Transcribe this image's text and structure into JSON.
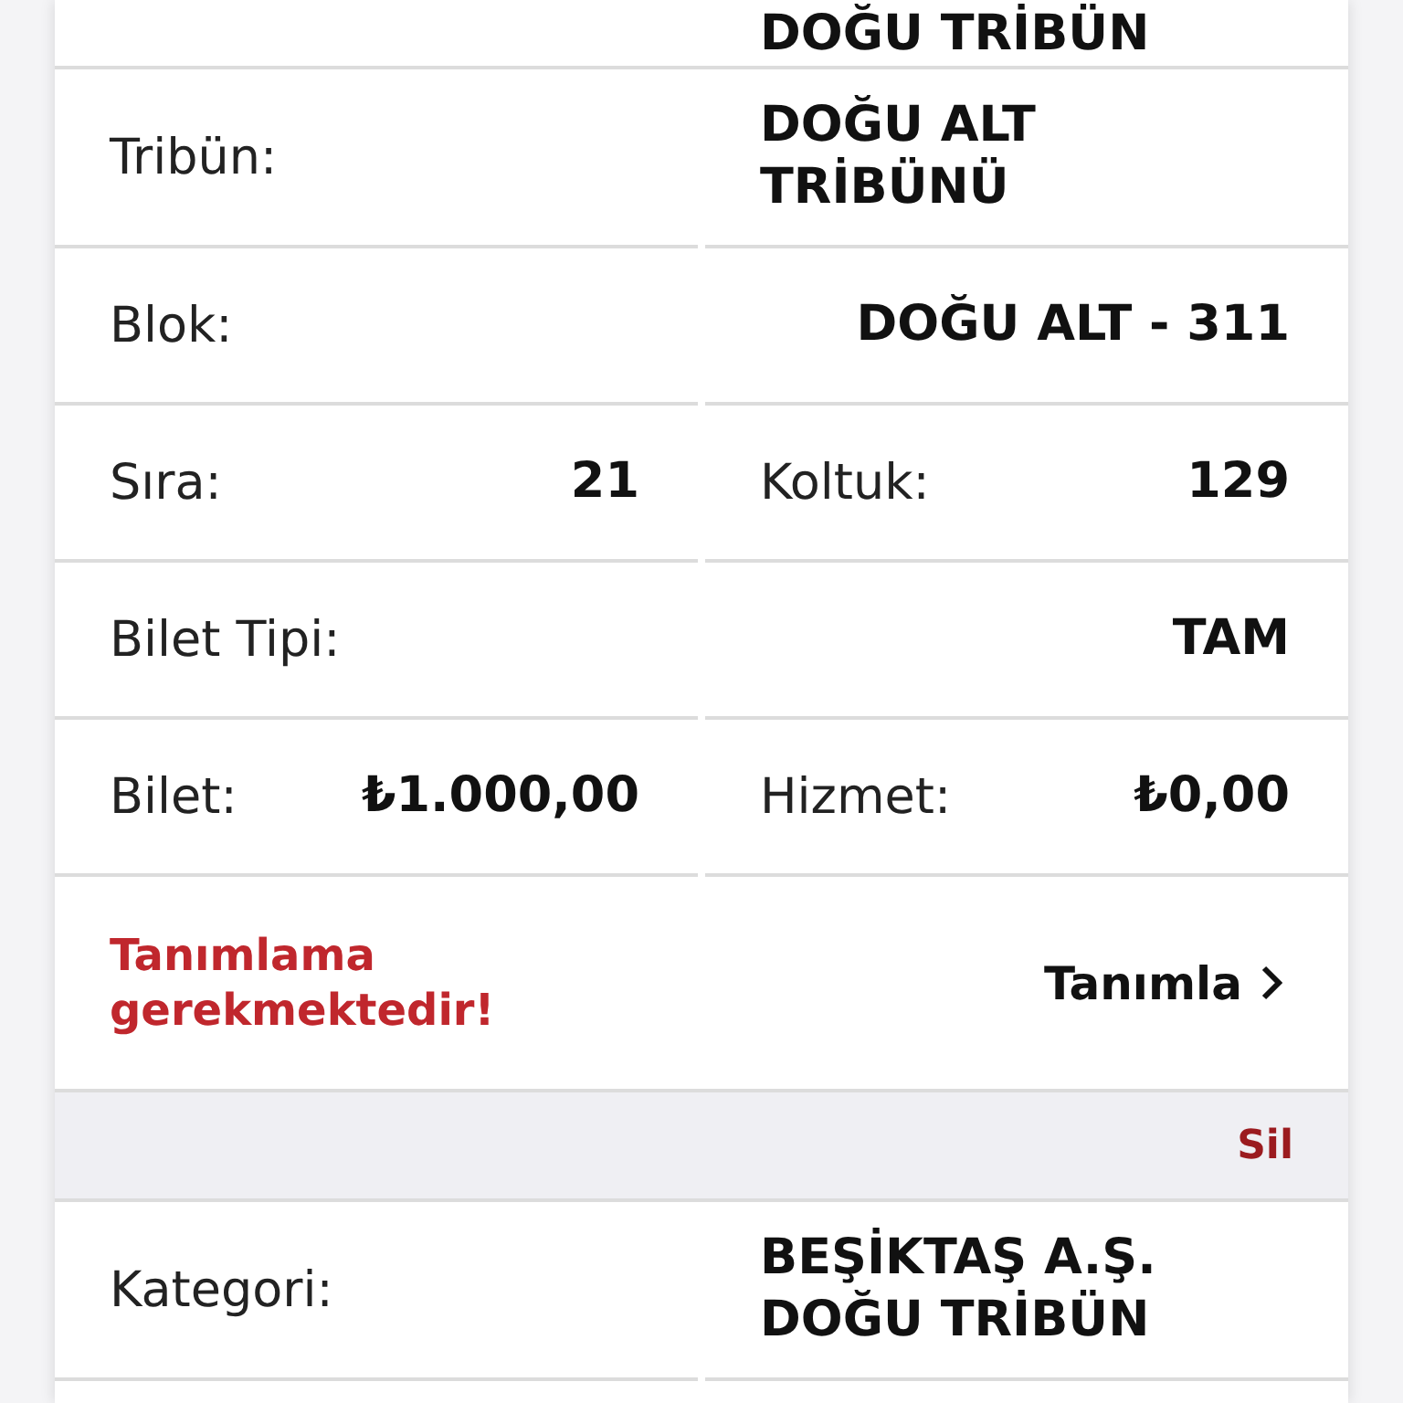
{
  "rows": [
    {
      "kind": "tail",
      "value": "DOĞU TRİBÜN"
    },
    {
      "kind": "single",
      "label": "Tribün:",
      "value": "DOĞU ALT TRİBÜNÜ"
    },
    {
      "kind": "single",
      "label": "Blok:",
      "value": "DOĞU ALT - 311"
    },
    {
      "kind": "pair",
      "label": "Sıra:",
      "value": "21",
      "label2": "Koltuk:",
      "value2": "129"
    },
    {
      "kind": "single",
      "label": "Bilet Tipi:",
      "value": "TAM"
    },
    {
      "kind": "pair",
      "label": "Bilet:",
      "value": "₺1.000,00",
      "label2": "Hizmet:",
      "value2": "₺0,00"
    },
    {
      "kind": "action",
      "warning": "Tanımlama gerekmektedir!",
      "link": "Tanımla"
    },
    {
      "kind": "delete",
      "text": "Sil"
    },
    {
      "kind": "single",
      "label": "Kategori:",
      "value": "BEŞİKTAŞ A.Ş. DOĞU TRİBÜN"
    }
  ]
}
